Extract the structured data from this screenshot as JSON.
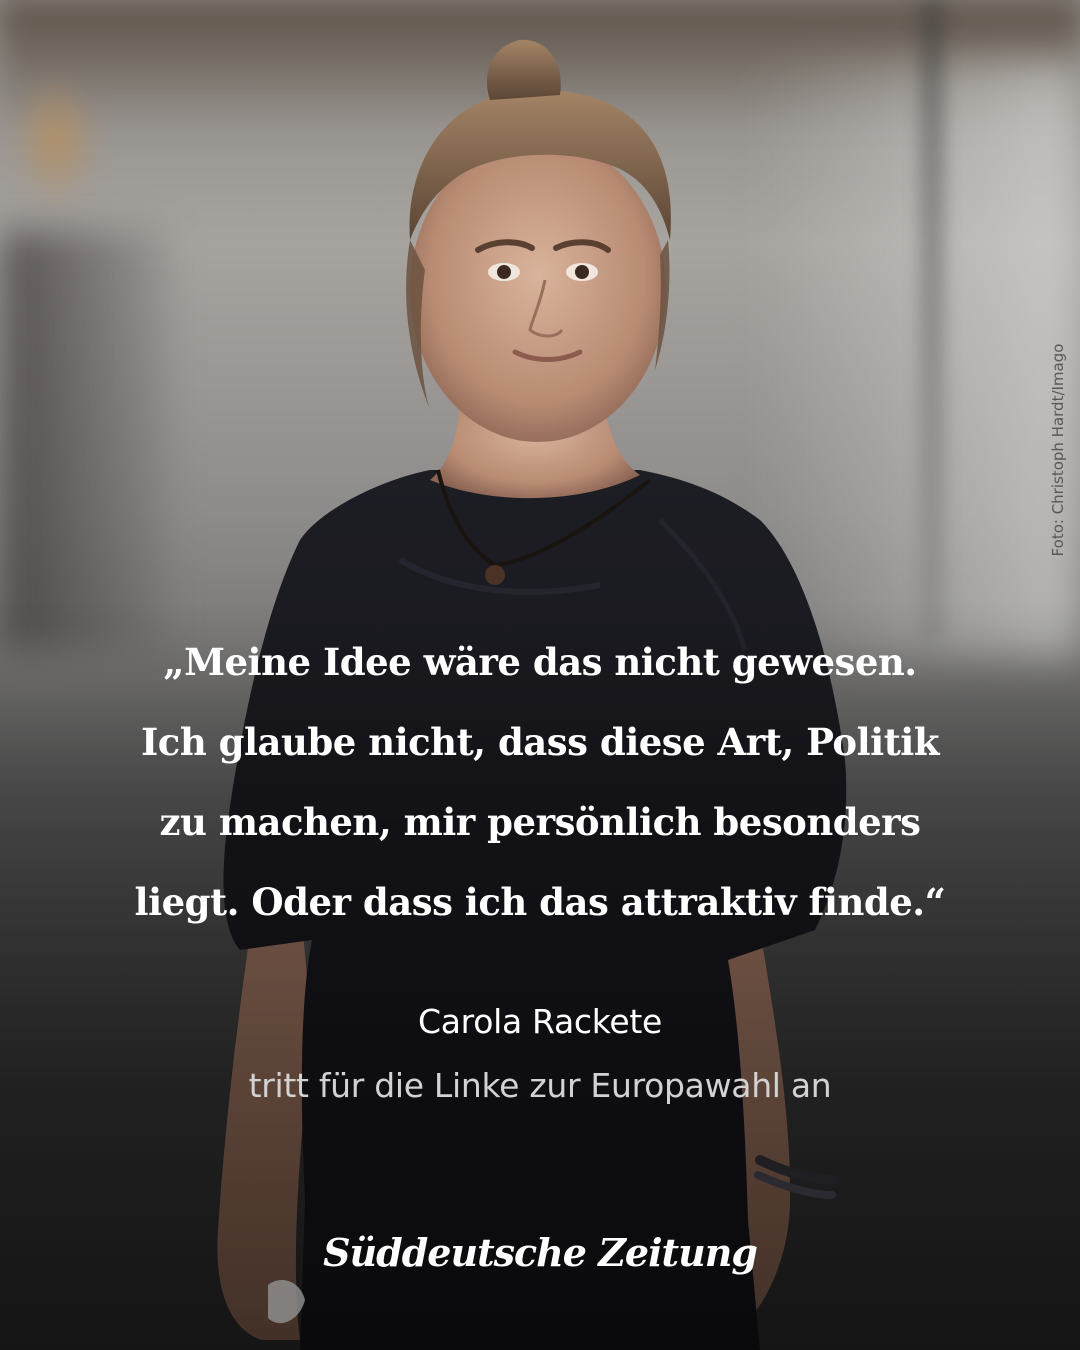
{
  "quote": {
    "lines": [
      "„Meine Idee wäre das nicht gewesen.",
      "Ich glaube nicht, dass diese Art, Politik",
      "zu machen, mir persönlich besonders",
      "liegt. Oder dass ich das attraktiv finde.“"
    ]
  },
  "speaker": {
    "name": "Carola Rackete",
    "description": "tritt für die Linke zur Europawahl an"
  },
  "brand": {
    "logo_text": "Süddeutsche Zeitung"
  },
  "photo_credit": "Foto: Christoph Hardt/Imago",
  "colors": {
    "text_primary": "#ffffff",
    "text_secondary": "#d2d2d2",
    "shirt": "#15151a"
  }
}
